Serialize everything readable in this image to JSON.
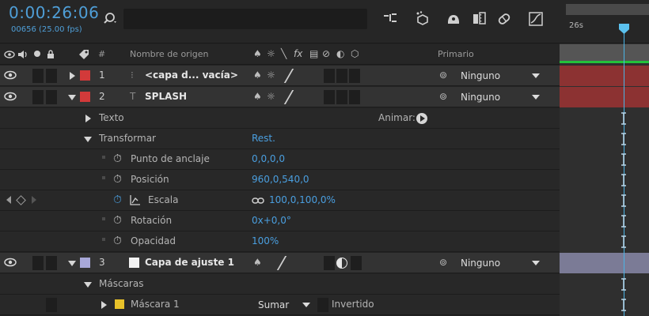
{
  "header": {
    "timecode": "0:00:26:06",
    "fps": "00656 (25.00 fps)",
    "icons": [
      "search-icon",
      "composition-flowchart-icon",
      "draft-3d-icon",
      "shy-layers-icon",
      "frame-blending-icon",
      "motion-blur-icon",
      "graph-editor-icon"
    ]
  },
  "columns": {
    "source_name": "Nombre de origen",
    "hash": "#",
    "parent": "Primario"
  },
  "timeline": {
    "ruler_label": "26s",
    "green_bar_color": "#23c23b",
    "cti_color": "#5bc1ee"
  },
  "layers": [
    {
      "num": "1",
      "name": "<capa d... vacía>",
      "label_color": "#d33a3a",
      "parent": "Ninguno",
      "bar_color": "#8c3232"
    },
    {
      "num": "2",
      "name": "SPLASH",
      "label_color": "#d33a3a",
      "parent": "Ninguno",
      "bar_color": "#8c3232"
    },
    {
      "num": "3",
      "name": "Capa de ajuste 1",
      "label_color": "#a8a8d8",
      "parent": "Ninguno",
      "bar_color": "#7b7b96"
    }
  ],
  "groups": {
    "text": "Texto",
    "animate": "Animar:",
    "transform": "Transformar",
    "reset": "Rest.",
    "masks": "Máscaras"
  },
  "properties": [
    {
      "name": "Punto de anclaje",
      "value": "0,0,0,0"
    },
    {
      "name": "Posición",
      "value": "960,0,540,0"
    },
    {
      "name": "Escala",
      "value": "100,0,100,0%"
    },
    {
      "name": "Rotación",
      "value": "0x+0,0°"
    },
    {
      "name": "Opacidad",
      "value": "100%"
    }
  ],
  "mask": {
    "name": "Máscara 1",
    "color": "#e8c22a",
    "mode": "Sumar",
    "inverted_label": "Invertido"
  }
}
